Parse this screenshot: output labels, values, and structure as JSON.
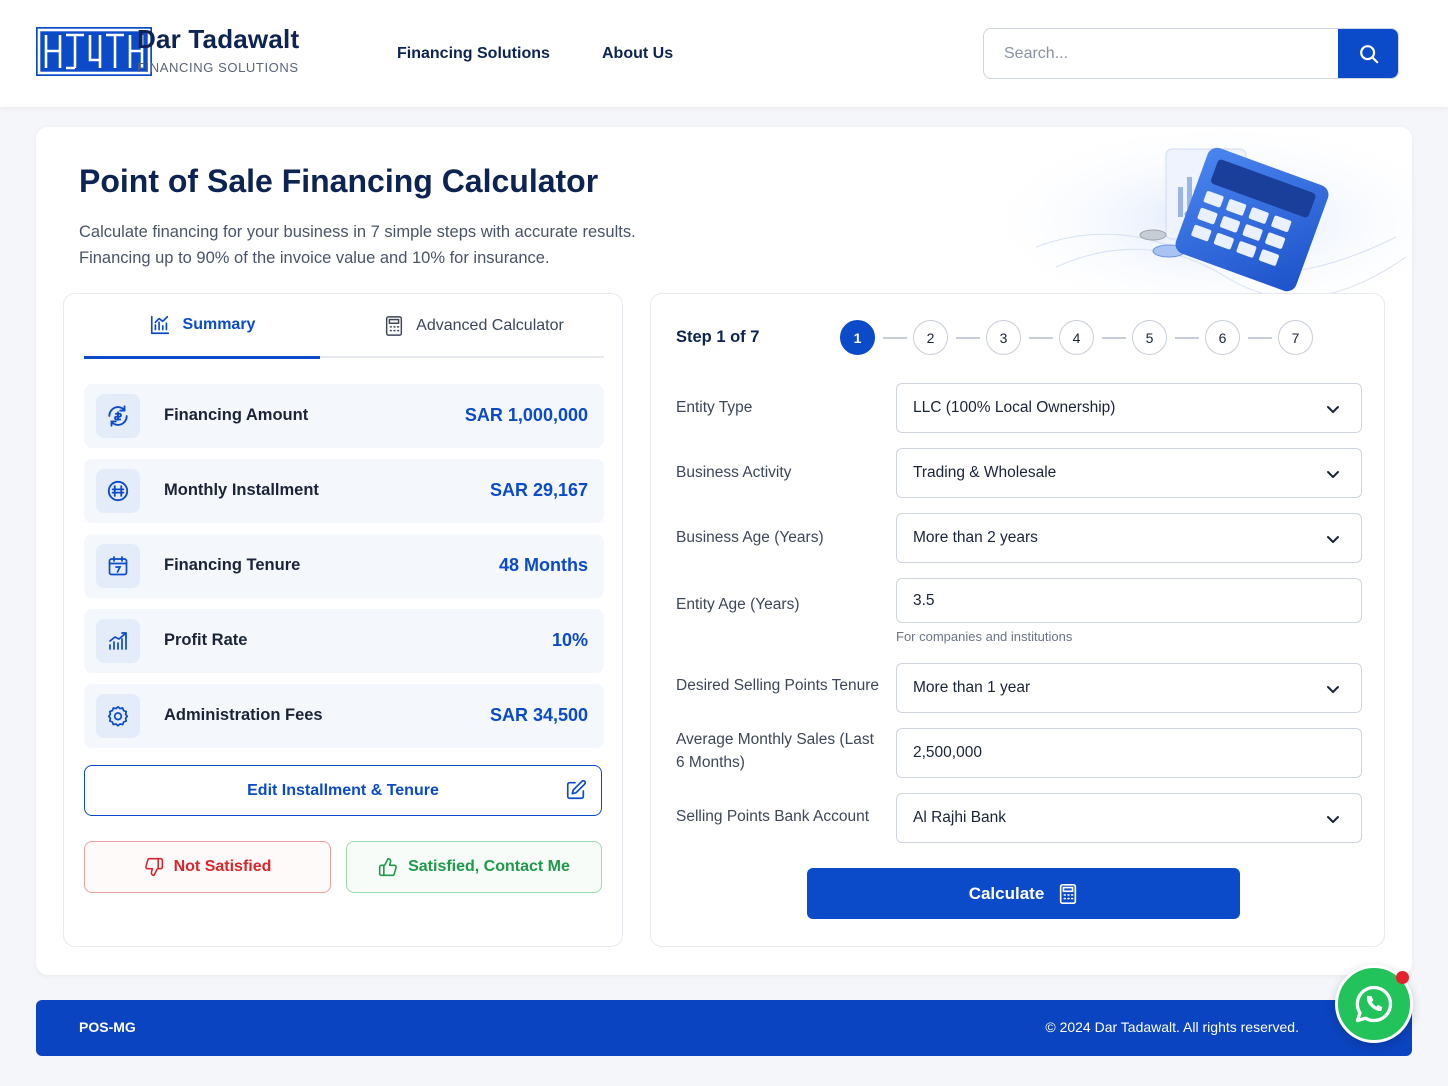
{
  "brand": {
    "name": "Dar Tadawalt",
    "tagline": "FINANCING SOLUTIONS",
    "logo_icon": "logo-mark"
  },
  "nav": {
    "items": [
      {
        "label": "Financing Solutions"
      },
      {
        "label": "About Us"
      }
    ]
  },
  "search": {
    "placeholder": "Search...",
    "value": "",
    "icon": "search-icon"
  },
  "page": {
    "title": "Point of Sale Financing Calculator",
    "description_line1": "Calculate financing for your business in 7 simple steps with accurate results.",
    "description_line2": "Financing up to 90% of the invoice value and 10% for insurance."
  },
  "tabs": [
    {
      "label": "Summary",
      "icon": "chart-icon",
      "active": true
    },
    {
      "label": "Advanced Calculator",
      "icon": "calculator-icon",
      "active": false
    }
  ],
  "summary": [
    {
      "label": "Financing Amount",
      "value": "SAR 1,000,000",
      "icon": "money-cycle-icon"
    },
    {
      "label": "Monthly Installment",
      "value": "SAR 29,167",
      "icon": "coin-icon"
    },
    {
      "label": "Financing Tenure",
      "value": "48 Months",
      "icon": "calendar-icon"
    },
    {
      "label": "Profit Rate",
      "value": "10%",
      "icon": "growth-chart-icon"
    },
    {
      "label": "Administration Fees",
      "value": "SAR 34,500",
      "icon": "gear-icon"
    }
  ],
  "actions": {
    "edit_label": "Edit Installment & Tenure",
    "not_satisfied_label": "Not Satisfied",
    "satisfied_label": "Satisfied, Contact Me"
  },
  "steps": {
    "label": "Step 1 of 7",
    "current": 1,
    "items": [
      "1",
      "2",
      "3",
      "4",
      "5",
      "6",
      "7"
    ]
  },
  "form": {
    "entity_type": {
      "label": "Entity Type",
      "value": "LLC (100% Local Ownership)"
    },
    "business_activity": {
      "label": "Business Activity",
      "value": "Trading & Wholesale"
    },
    "business_age": {
      "label": "Business Age (Years)",
      "value": "More than 2 years"
    },
    "entity_age": {
      "label": "Entity Age (Years)",
      "value": "3.5",
      "hint": "For companies and institutions"
    },
    "selling_points_tenure": {
      "label": "Desired Selling Points Tenure",
      "value": "More than 1 year"
    },
    "monthly_sales": {
      "label": "Average Monthly Sales (Last 6 Months)",
      "value": "2,500,000"
    },
    "bank_account": {
      "label": "Selling Points Bank Account",
      "value": "Al Rajhi Bank"
    }
  },
  "calculate_label": "Calculate",
  "footer": {
    "code": "POS-MG",
    "copyright": "© 2024 Dar Tadawalt. All rights reserved."
  },
  "colors": {
    "primary": "#0b4ac8",
    "danger": "#d9262c",
    "success": "#1e9a4a",
    "whatsapp": "#22c35a"
  }
}
